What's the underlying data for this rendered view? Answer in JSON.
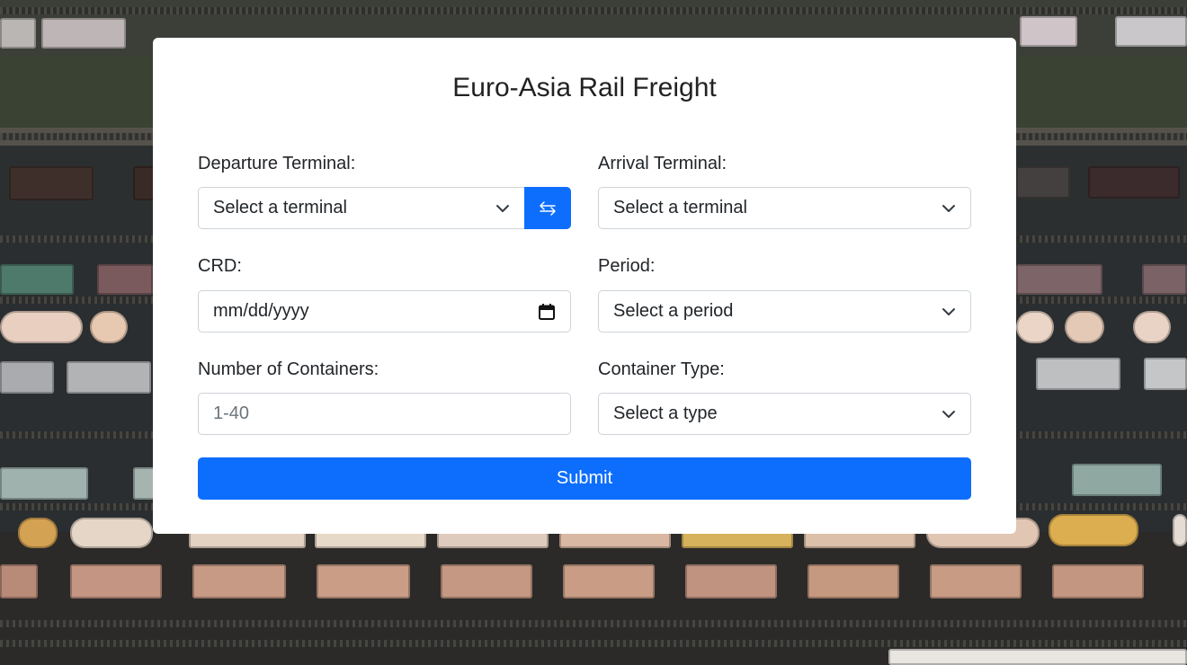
{
  "form": {
    "title": "Euro-Asia Rail Freight",
    "departure": {
      "label": "Departure Terminal:",
      "value": "Select a terminal",
      "icon": "chevron-down-icon"
    },
    "swap": {
      "icon": "swap-arrows-icon",
      "color": "#0d6efd"
    },
    "arrival": {
      "label": "Arrival Terminal:",
      "value": "Select a terminal",
      "icon": "chevron-down-icon"
    },
    "crd": {
      "label": "CRD:",
      "value": "mm/dd/yyyy",
      "icon": "calendar-icon"
    },
    "period": {
      "label": "Period:",
      "value": "Select a period",
      "icon": "chevron-down-icon"
    },
    "containers": {
      "label": "Number of Containers:",
      "placeholder": "1-40",
      "value": ""
    },
    "container_type": {
      "label": "Container Type:",
      "value": "Select a type",
      "icon": "chevron-down-icon"
    },
    "submit_label": "Submit",
    "accent_color": "#0d6efd"
  },
  "background": {
    "description_icon": "rail-yard-aerial-image"
  }
}
